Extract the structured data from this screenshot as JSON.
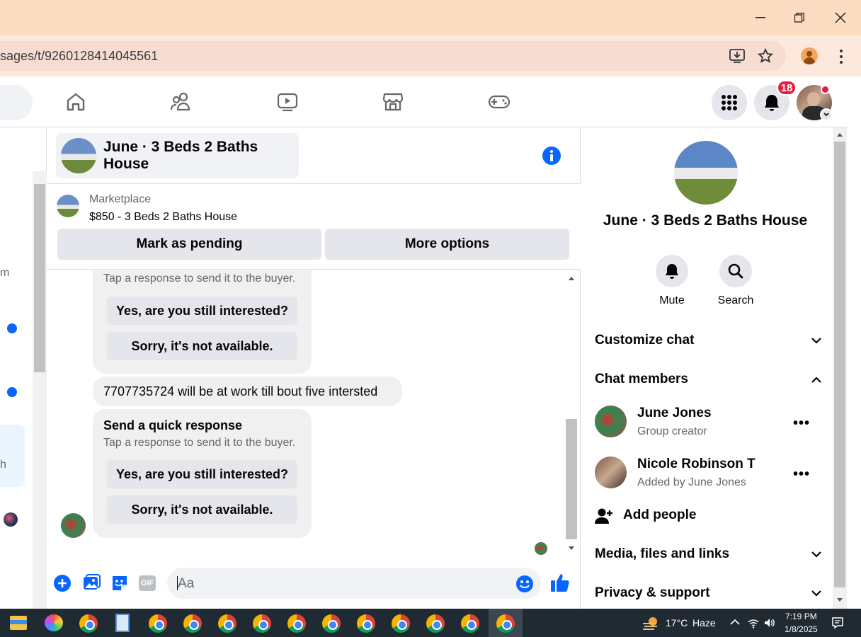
{
  "browser": {
    "url": "sages/t/9260128414045561"
  },
  "nav": {
    "notification_count": "18"
  },
  "chat": {
    "title": "June · 3 Beds 2 Baths House",
    "marketplace_label": "Marketplace",
    "listing": "$850 - 3 Beds 2 Baths House",
    "mark_pending": "Mark as pending",
    "more_options": "More options",
    "messages": {
      "tap_hint_1": "Tap a response to send it to the buyer.",
      "q1_yes": "Yes, are you still interested?",
      "q1_no": "Sorry, it's not available.",
      "buyer_message": "7707735724 will be at work till bout five intersted",
      "quick_title": "Send a quick response",
      "tap_hint_2": "Tap a response to send it to the buyer.",
      "q2_yes": "Yes, are you still interested?",
      "q2_no": "Sorry, it's not available."
    },
    "composer_placeholder": "Aa"
  },
  "left_fragments": {
    "m": "m",
    "h": "h"
  },
  "right_panel": {
    "title": "June · 3 Beds 2 Baths House",
    "mute": "Mute",
    "search": "Search",
    "customize": "Customize chat",
    "members_header": "Chat members",
    "members": [
      {
        "name": "June Jones",
        "role": "Group creator"
      },
      {
        "name": "Nicole Robinson T",
        "role": "Added by June Jones"
      }
    ],
    "add_people": "Add people",
    "media": "Media, files and links",
    "privacy": "Privacy & support"
  },
  "taskbar": {
    "weather": "17°C",
    "weather_desc": "Haze",
    "time": "7:19 PM",
    "date": "1/8/2025"
  }
}
